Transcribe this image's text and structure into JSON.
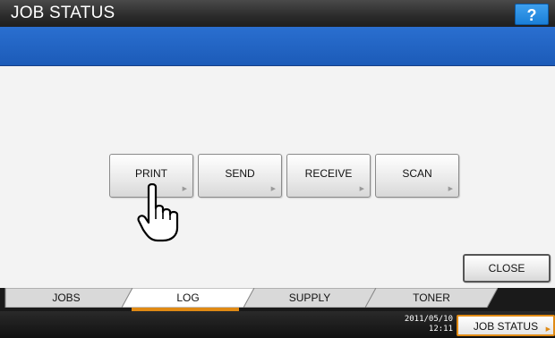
{
  "header": {
    "title": "JOB STATUS",
    "help_label": "?"
  },
  "main": {
    "log_buttons": [
      {
        "label": "PRINT"
      },
      {
        "label": "SEND"
      },
      {
        "label": "RECEIVE"
      },
      {
        "label": "SCAN"
      }
    ],
    "close_label": "CLOSE"
  },
  "tabs": [
    {
      "label": "JOBS",
      "selected": false
    },
    {
      "label": "LOG",
      "selected": true
    },
    {
      "label": "SUPPLY",
      "selected": false
    },
    {
      "label": "TONER",
      "selected": false
    }
  ],
  "status": {
    "date": "2011/05/10",
    "time": "12:11",
    "job_status_label": "JOB STATUS"
  },
  "colors": {
    "titlebar": "#2b2b2b",
    "message_bar": "#1c5bb8",
    "help_button": "#1a7fd8",
    "active_tab_accent": "#e08a14"
  },
  "icons": {
    "pointer": "pointing-hand-icon",
    "more": "triangle-right-icon"
  }
}
